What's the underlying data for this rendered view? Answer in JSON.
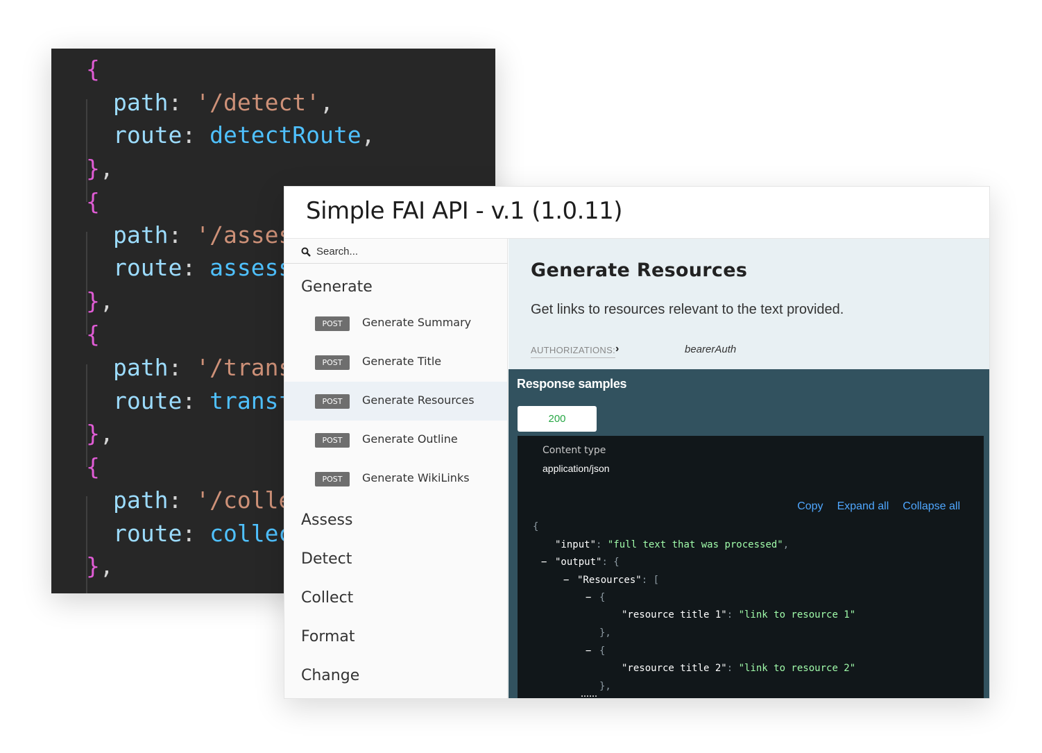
{
  "editor": {
    "lines": [
      {
        "kind": "open",
        "text": "{"
      },
      {
        "kind": "prop",
        "key": "path",
        "value": "'/detect'",
        "suffix": ",",
        "valueType": "string"
      },
      {
        "kind": "prop",
        "key": "route",
        "value": "detectRoute",
        "suffix": ",",
        "valueType": "ident"
      },
      {
        "kind": "close",
        "text": "},"
      },
      {
        "kind": "open",
        "text": "{"
      },
      {
        "kind": "prop",
        "key": "path",
        "value": "'/asses",
        "suffix": "",
        "valueType": "string"
      },
      {
        "kind": "prop",
        "key": "route",
        "value": "assess",
        "suffix": "",
        "valueType": "ident"
      },
      {
        "kind": "close",
        "text": "},"
      },
      {
        "kind": "open",
        "text": "{"
      },
      {
        "kind": "prop",
        "key": "path",
        "value": "'/trans",
        "suffix": "",
        "valueType": "string"
      },
      {
        "kind": "prop",
        "key": "route",
        "value": "transf",
        "suffix": "",
        "valueType": "ident"
      },
      {
        "kind": "close",
        "text": "},"
      },
      {
        "kind": "open",
        "text": "{"
      },
      {
        "kind": "prop",
        "key": "path",
        "value": "'/colle",
        "suffix": "",
        "valueType": "string"
      },
      {
        "kind": "prop",
        "key": "route",
        "value": "collec",
        "suffix": "",
        "valueType": "ident"
      },
      {
        "kind": "close",
        "text": "},"
      }
    ]
  },
  "docs": {
    "title": "Simple FAI API - v.1 (1.0.11)",
    "search": {
      "placeholder": "Search...",
      "icon": "search-icon"
    },
    "sidebar": {
      "groups": [
        {
          "label": "Generate"
        },
        {
          "label": "Assess"
        },
        {
          "label": "Detect"
        },
        {
          "label": "Collect"
        },
        {
          "label": "Format"
        },
        {
          "label": "Change"
        }
      ],
      "operations": [
        {
          "method": "POST",
          "label": "Generate Summary",
          "active": false
        },
        {
          "method": "POST",
          "label": "Generate Title",
          "active": false
        },
        {
          "method": "POST",
          "label": "Generate Resources",
          "active": true
        },
        {
          "method": "POST",
          "label": "Generate Outline",
          "active": false
        },
        {
          "method": "POST",
          "label": "Generate WikiLinks",
          "active": false
        }
      ]
    },
    "operation": {
      "title": "Generate Resources",
      "description": "Get links to resources relevant to the text provided.",
      "auth_label": "AUTHORIZATIONS:",
      "auth_value": "bearerAuth"
    },
    "responses": {
      "title": "Response samples",
      "tab": "200",
      "content_type_label": "Content type",
      "content_type_value": "application/json",
      "tools": [
        "Copy",
        "Expand all",
        "Collapse all"
      ],
      "json_lines": [
        {
          "indent": 0,
          "toggle": "",
          "parts": [
            [
              "p",
              "{"
            ]
          ]
        },
        {
          "indent": 1,
          "toggle": "",
          "parts": [
            [
              "k",
              "\"input\""
            ],
            [
              "p",
              ": "
            ],
            [
              "s",
              "\"full text that was processed\""
            ],
            [
              "p",
              ","
            ]
          ]
        },
        {
          "indent": 1,
          "toggle": "−",
          "parts": [
            [
              "k",
              "\"output\""
            ],
            [
              "p",
              ": {"
            ]
          ]
        },
        {
          "indent": 2,
          "toggle": "−",
          "parts": [
            [
              "k",
              "\"Resources\""
            ],
            [
              "p",
              ": ["
            ]
          ]
        },
        {
          "indent": 3,
          "toggle": "−",
          "parts": [
            [
              "p",
              "{"
            ]
          ]
        },
        {
          "indent": 4,
          "toggle": "",
          "parts": [
            [
              "k",
              "\"resource title 1\""
            ],
            [
              "p",
              ": "
            ],
            [
              "s",
              "\"link to resource 1\""
            ]
          ]
        },
        {
          "indent": 3,
          "toggle": "",
          "parts": [
            [
              "p",
              "},"
            ]
          ]
        },
        {
          "indent": 3,
          "toggle": "−",
          "parts": [
            [
              "p",
              "{"
            ]
          ]
        },
        {
          "indent": 4,
          "toggle": "",
          "parts": [
            [
              "k",
              "\"resource title 2\""
            ],
            [
              "p",
              ": "
            ],
            [
              "s",
              "\"link to resource 2\""
            ]
          ]
        },
        {
          "indent": 3,
          "toggle": "",
          "parts": [
            [
              "p",
              "},"
            ]
          ]
        }
      ]
    }
  },
  "colors": {
    "editor_bg": "#272727",
    "brace": "#e05cd5",
    "key": "#9cdcfe",
    "string": "#ce9178",
    "ident": "#4fc1ff",
    "badge": "#6e6e6e",
    "response_bg": "#32525f",
    "status_ok": "#28a745",
    "link": "#4fa7ff"
  }
}
